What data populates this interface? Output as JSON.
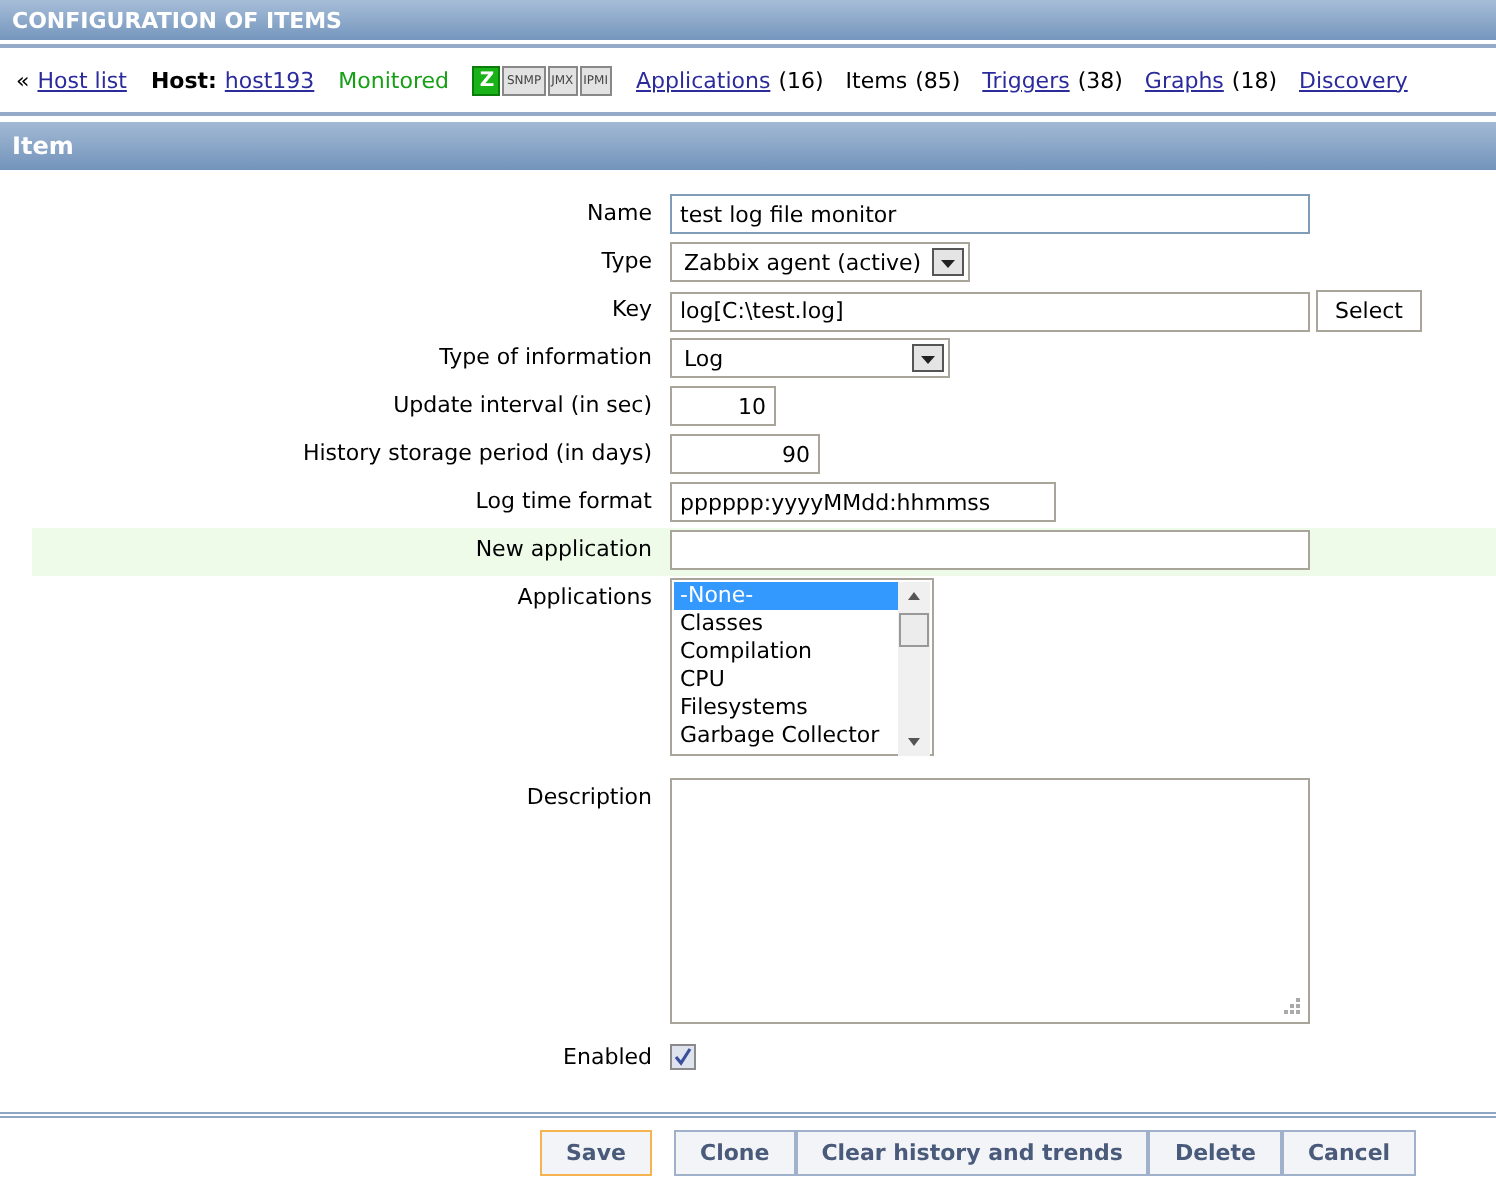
{
  "page_title": "CONFIGURATION OF ITEMS",
  "nav": {
    "back": "«",
    "host_list": "Host list",
    "host_label": "Host:",
    "host": "host193",
    "status": "Monitored",
    "availability": [
      {
        "label": "Z",
        "available": true
      },
      {
        "label": "SNMP",
        "available": false
      },
      {
        "label": "JMX",
        "available": false
      },
      {
        "label": "IPMI",
        "available": false
      }
    ],
    "links": [
      {
        "label": "Applications",
        "count": "(16)",
        "selected": false
      },
      {
        "label": "Items",
        "count": "(85)",
        "selected": true
      },
      {
        "label": "Triggers",
        "count": "(38)",
        "selected": false
      },
      {
        "label": "Graphs",
        "count": "(18)",
        "selected": false
      },
      {
        "label": "Discovery",
        "selected": false
      }
    ]
  },
  "section_title": "Item",
  "fields": [
    {
      "kind": "text",
      "label": "Name",
      "value": "test log file monitor",
      "focused": true
    },
    {
      "kind": "select",
      "label": "Type",
      "value": "Zabbix agent (active)"
    },
    {
      "kind": "text_button",
      "label": "Key",
      "value": "log[C:\\test.log]",
      "button": "Select"
    },
    {
      "kind": "select",
      "label": "Type of information",
      "value": "Log"
    },
    {
      "kind": "number",
      "label": "Update interval (in sec)",
      "value": "10"
    },
    {
      "kind": "number",
      "label": "History storage period (in days)",
      "value": "90"
    },
    {
      "kind": "text",
      "label": "Log time format",
      "value": "pppppp:yyyyMMdd:hhmmss",
      "focused": false
    },
    {
      "kind": "text",
      "label": "New application",
      "focused": false,
      "highlighted": true
    },
    {
      "kind": "listbox",
      "label": "Applications",
      "options": [
        {
          "label": "-None-",
          "selected": true
        },
        {
          "label": "Classes",
          "selected": false
        },
        {
          "label": "Compilation",
          "selected": false
        },
        {
          "label": "CPU",
          "selected": false
        },
        {
          "label": "Filesystems",
          "selected": false
        },
        {
          "label": "Garbage Collector",
          "selected": false
        }
      ]
    },
    {
      "kind": "textarea",
      "label": "Description"
    },
    {
      "kind": "checkbox",
      "label": "Enabled",
      "checked": true
    }
  ],
  "buttons": [
    {
      "label": "Save",
      "primary": true
    },
    {
      "label": "Clone",
      "primary": false
    },
    {
      "label": "Clear history and trends",
      "primary": false
    },
    {
      "label": "Delete",
      "primary": false
    },
    {
      "label": "Cancel",
      "primary": false
    }
  ]
}
